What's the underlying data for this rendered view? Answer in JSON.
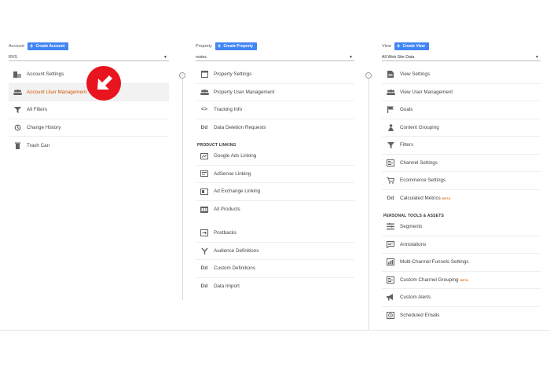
{
  "account": {
    "label": "Account",
    "create_label": "Create Account",
    "selected": "RVS",
    "items": [
      {
        "label": "Account Settings",
        "icon": "building-icon"
      },
      {
        "label": "Account User Management",
        "icon": "users-icon"
      },
      {
        "label": "All Filters",
        "icon": "filter-icon"
      },
      {
        "label": "Change History",
        "icon": "history-icon"
      },
      {
        "label": "Trash Can",
        "icon": "trash-icon"
      }
    ]
  },
  "property": {
    "label": "Property",
    "create_label": "Create Property",
    "selected": "rvstec",
    "items": [
      {
        "label": "Property Settings",
        "icon": "settings-page-icon"
      },
      {
        "label": "Property User Management",
        "icon": "users-icon"
      },
      {
        "label": "Tracking Info",
        "icon": "code-icon"
      },
      {
        "label": "Data Deletion Requests",
        "icon": "dd-icon"
      }
    ],
    "section": "PRODUCT LINKING",
    "linking": [
      {
        "label": "Google Ads Linking",
        "icon": "ads-icon"
      },
      {
        "label": "AdSense Linking",
        "icon": "adsense-icon"
      },
      {
        "label": "Ad Exchange Linking",
        "icon": "adexchange-icon"
      },
      {
        "label": "All Products",
        "icon": "products-icon"
      }
    ],
    "other": [
      {
        "label": "Postbacks",
        "icon": "postbacks-icon"
      },
      {
        "label": "Audience Definitions",
        "icon": "fork-icon"
      },
      {
        "label": "Custom Definitions",
        "icon": "dd-icon"
      },
      {
        "label": "Data Import",
        "icon": "dd-icon"
      }
    ]
  },
  "view": {
    "label": "View",
    "create_label": "Create View",
    "selected": "All Web Site Data",
    "items": [
      {
        "label": "View Settings",
        "icon": "page-icon"
      },
      {
        "label": "View User Management",
        "icon": "users-icon"
      },
      {
        "label": "Goals",
        "icon": "flag-icon"
      },
      {
        "label": "Content Grouping",
        "icon": "person-icon"
      },
      {
        "label": "Filters",
        "icon": "filter-icon"
      },
      {
        "label": "Channel Settings",
        "icon": "channel-icon"
      },
      {
        "label": "Ecommerce Settings",
        "icon": "cart-icon"
      },
      {
        "label": "Calculated Metrics",
        "icon": "dd-icon",
        "beta": "BETA"
      }
    ],
    "section": "PERSONAL TOOLS & ASSETS",
    "tools": [
      {
        "label": "Segments",
        "icon": "segments-icon"
      },
      {
        "label": "Annotations",
        "icon": "comment-icon"
      },
      {
        "label": "Multi-Channel Funnels Settings",
        "icon": "chart-icon"
      },
      {
        "label": "Custom Channel Grouping",
        "icon": "channel-icon",
        "beta": "BETA"
      },
      {
        "label": "Custom Alerts",
        "icon": "megaphone-icon"
      },
      {
        "label": "Scheduled Emails",
        "icon": "clock-icon"
      }
    ]
  },
  "icon_dd_text": "Dd",
  "arrow_color": "#e8141e",
  "accent": "#4285f4",
  "active_text": "#d35400"
}
